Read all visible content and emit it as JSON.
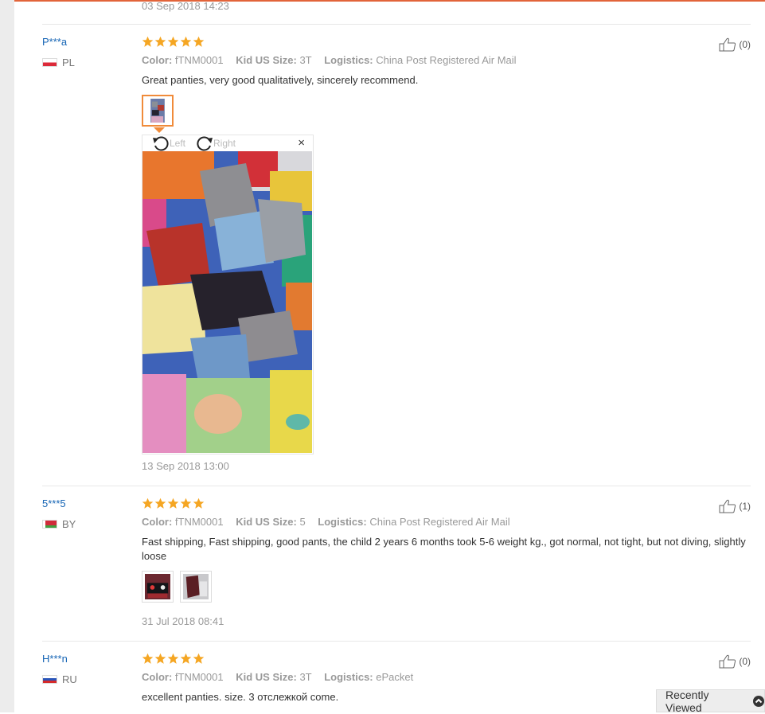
{
  "top_date": "03 Sep 2018 14:23",
  "reviews": [
    {
      "user": "P***a",
      "country": "PL",
      "color_label": "Color:",
      "color_value": "fTNM0001",
      "size_label": "Kid US Size:",
      "size_value": "3T",
      "logistics_label": "Logistics:",
      "logistics_value": "China Post Registered Air Mail",
      "text": "Great panties, very good qualitatively, sincerely recommend.",
      "helpful": "(0)",
      "date": "13 Sep 2018 13:00"
    },
    {
      "user": "5***5",
      "country": "BY",
      "color_label": "Color:",
      "color_value": "fTNM0001",
      "size_label": "Kid US Size:",
      "size_value": "5",
      "logistics_label": "Logistics:",
      "logistics_value": "China Post Registered Air Mail",
      "text": "Fast shipping, Fast shipping, good pants, the child 2 years 6 months took 5-6 weight kg., got normal, not tight, but not diving, slightly loose",
      "helpful": "(1)",
      "date": "31 Jul 2018 08:41"
    },
    {
      "user": "H***n",
      "country": "RU",
      "color_label": "Color:",
      "color_value": "fTNM0001",
      "size_label": "Kid US Size:",
      "size_value": "3T",
      "logistics_label": "Logistics:",
      "logistics_value": "ePacket",
      "text": "excellent panties. size. 3 отслежкой come.",
      "helpful": "(0)"
    }
  ],
  "viewer": {
    "rotate_left": "Left",
    "rotate_right": "Right",
    "close": "×"
  },
  "recently_viewed": "Recently Viewed",
  "colors": {
    "accent": "#e2643a",
    "star": "#f5a623",
    "link": "#1665b5"
  }
}
